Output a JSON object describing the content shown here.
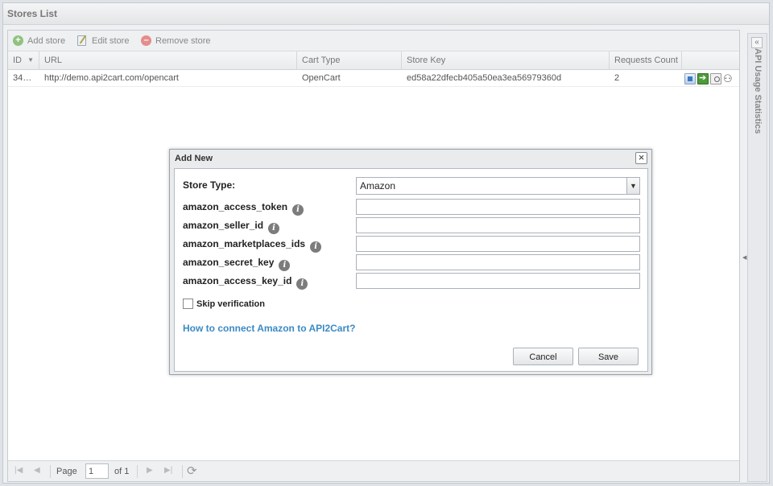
{
  "panel": {
    "title": "Stores List"
  },
  "toolbar": {
    "add_label": "Add store",
    "edit_label": "Edit store",
    "remove_label": "Remove store"
  },
  "table": {
    "columns": [
      "ID",
      "URL",
      "Cart Type",
      "Store Key",
      "Requests Count"
    ],
    "rows": [
      {
        "id": "34…",
        "url": "http://demo.api2cart.com/opencart",
        "cart_type": "OpenCart",
        "store_key": "ed58a22dfecb405a50ea3ea56979360d",
        "requests": "2"
      }
    ]
  },
  "pager": {
    "page_label": "Page",
    "page_value": "1",
    "of_label": "of 1"
  },
  "sidebar": {
    "title": "API Usage Statistics"
  },
  "modal": {
    "title": "Add New",
    "store_type_label": "Store Type:",
    "store_type_value": "Amazon",
    "fields": [
      "amazon_access_token",
      "amazon_seller_id",
      "amazon_marketplaces_ids",
      "amazon_secret_key",
      "amazon_access_key_id"
    ],
    "info_glyph": "i",
    "skip_label": "Skip verification",
    "help_link": "How to connect Amazon to API2Cart?",
    "cancel_label": "Cancel",
    "save_label": "Save"
  },
  "colors": {
    "link": "#3b8ac4",
    "add_icon": "#8fc27e",
    "remove_icon": "#e58c8c"
  },
  "icons": [
    "add-icon",
    "edit-icon",
    "remove-icon",
    "sort-desc-icon",
    "info-icon",
    "close-icon",
    "chevron-down-icon",
    "refresh-icon",
    "collapse-icon"
  ]
}
